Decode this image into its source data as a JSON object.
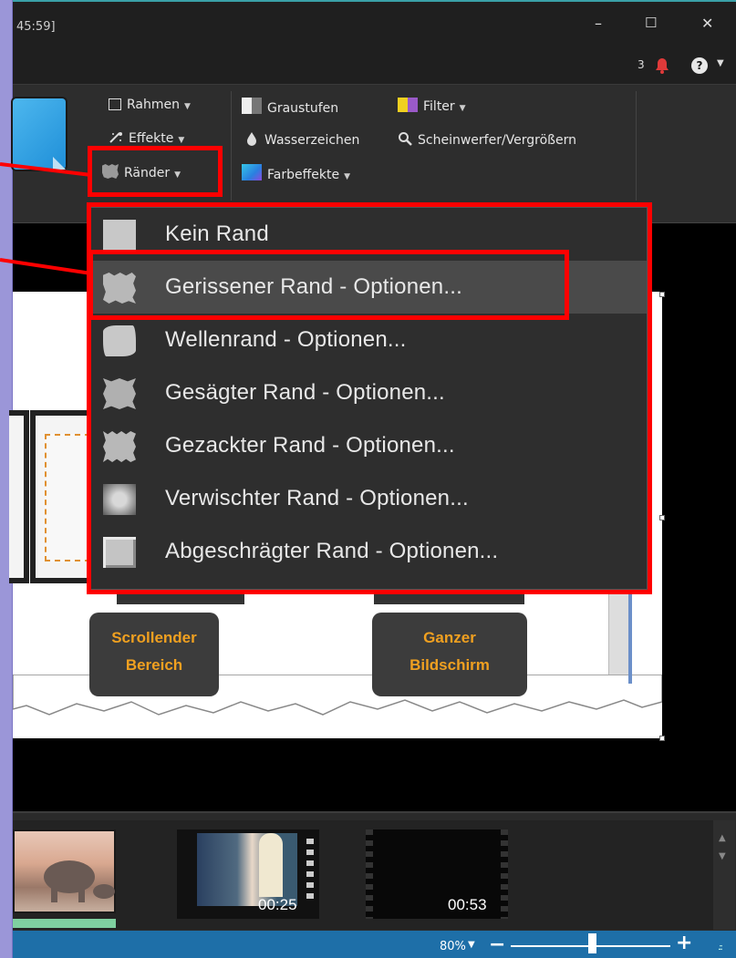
{
  "window": {
    "title_fragment": "45:59]",
    "minimize": "–",
    "maximize": "☐",
    "close": "✕",
    "notification_count": "3",
    "help_symbol": "?"
  },
  "ribbon": {
    "col1": [
      {
        "label": "Rahmen",
        "icon": "frame-icon"
      },
      {
        "label": "Effekte",
        "icon": "effects-icon"
      },
      {
        "label": "Ränder",
        "icon": "edges-icon"
      }
    ],
    "col2": [
      {
        "label": "Graustufen",
        "icon": "grayscale-icon"
      },
      {
        "label": "Wasserzeichen",
        "icon": "watermark-icon"
      },
      {
        "label": "Farbeffekte",
        "icon": "color-effects-icon"
      }
    ],
    "col3": [
      {
        "label": "Filter",
        "icon": "filter-icon"
      },
      {
        "label": "Scheinwerfer/Vergrößern",
        "icon": "spotlight-icon"
      }
    ]
  },
  "menu": {
    "items": [
      {
        "label": "Kein Rand",
        "icon": "no-edge-icon"
      },
      {
        "label": "Gerissener Rand - Optionen...",
        "icon": "torn-edge-icon"
      },
      {
        "label": "Wellenrand - Optionen...",
        "icon": "wavy-edge-icon"
      },
      {
        "label": "Gesägter Rand - Optionen...",
        "icon": "sawtooth-edge-icon"
      },
      {
        "label": "Gezackter Rand - Optionen...",
        "icon": "zigzag-edge-icon"
      },
      {
        "label": "Verwischter Rand - Optionen...",
        "icon": "blurred-edge-icon"
      },
      {
        "label": "Abgeschrägter Rand - Optionen...",
        "icon": "beveled-edge-icon"
      }
    ],
    "highlighted_index": 1
  },
  "slide": {
    "pill_left": [
      "Scrollender",
      "Bereich"
    ],
    "pill_right": [
      "Ganzer",
      "Bildschirm"
    ]
  },
  "timeline": {
    "clips": [
      {
        "time": ""
      },
      {
        "time": "00:25"
      },
      {
        "time": "00:53"
      }
    ]
  },
  "status": {
    "zoom": "80%",
    "minus": "−",
    "plus": "+",
    "grip": ".::"
  },
  "colors": {
    "annotation_red": "#ff0000",
    "status_blue": "#1e6fa8",
    "pill_text_orange": "#f0a020"
  }
}
